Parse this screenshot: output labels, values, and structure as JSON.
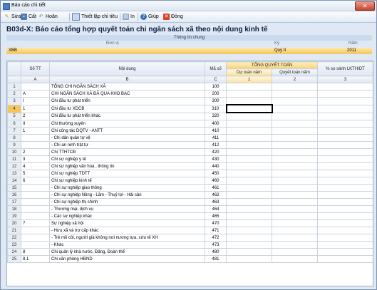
{
  "window": {
    "title": "Báo cáo chi tiết"
  },
  "toolbar": {
    "edit": "Sửa",
    "save": "Cất",
    "undo": "Hoãn",
    "setup": "Thiết lập chỉ tiêu",
    "print": "In",
    "help": "Giúp",
    "close": "Đóng"
  },
  "report": {
    "title": "B03d-X: Báo cáo tổng hợp quyết toán chi ngân sách xã theo nội dung kinh tế",
    "info_header": "Thông tin chung",
    "info_labels": {
      "unit": "Đơn vị",
      "period": "Kỳ",
      "year": "Năm"
    },
    "info_values": {
      "unit": "XBB",
      "period": "Quý II",
      "year": "2011"
    }
  },
  "table": {
    "headers": {
      "stt": "Số TT",
      "content": "Nội dung",
      "code": "Mã số",
      "summary": "TỔNG QUYẾT TOÁN",
      "estimate": "Dự toán năm",
      "settlement": "Quyết toán năm",
      "compare": "% so sánh LKTH/DT"
    },
    "letters": {
      "stt": "A",
      "content": "B",
      "code": "C",
      "estimate": "1",
      "settlement": "2",
      "compare": "3"
    },
    "rows": [
      {
        "n": "1",
        "stt": "",
        "content": "TỔNG CHI NGÂN SÁCH XÃ",
        "code": "100"
      },
      {
        "n": "2",
        "stt": "A",
        "content": "CHI NGÂN SÁCH XÃ ĐÃ QUA KHO BẠC",
        "code": "200"
      },
      {
        "n": "3",
        "stt": "I",
        "content": "Chi đầu tư phát triển",
        "code": "300"
      },
      {
        "n": "4",
        "stt": "1",
        "content": "Chi đầu tư XDCB",
        "code": "310"
      },
      {
        "n": "5",
        "stt": "2",
        "content": "Chi đầu tư phát triển khác",
        "code": "320"
      },
      {
        "n": "6",
        "stt": "II",
        "content": "Chi thường xuyên",
        "code": "400"
      },
      {
        "n": "7",
        "stt": "1",
        "content": "Chi công tác DQTV - ANTT",
        "code": "410"
      },
      {
        "n": "8",
        "stt": "",
        "content": " - Chi dân quân tự vệ",
        "code": "411"
      },
      {
        "n": "9",
        "stt": "",
        "content": " - Chi an ninh trật tự",
        "code": "412"
      },
      {
        "n": "10",
        "stt": "2",
        "content": "Chi TTHTCĐ",
        "code": "420"
      },
      {
        "n": "11",
        "stt": "3",
        "content": "Chi sự nghiệp y tế",
        "code": "430"
      },
      {
        "n": "12",
        "stt": "4",
        "content": "Chi sự nghiệp văn hoá , thông tin",
        "code": "440"
      },
      {
        "n": "13",
        "stt": "5",
        "content": "Chi sự nghiệp TDTT",
        "code": "450"
      },
      {
        "n": "14",
        "stt": "6",
        "content": "Chi sự nghiệp kinh tế",
        "code": "460"
      },
      {
        "n": "15",
        "stt": "",
        "content": " - Chi sự nghiệp giao thông",
        "code": "461"
      },
      {
        "n": "16",
        "stt": "",
        "content": " - Chi sự nghiệp Nông - Lâm - Thuỷ lợi - Hải sản",
        "code": "462"
      },
      {
        "n": "17",
        "stt": "",
        "content": " - Chi sự nghiệp thị chính",
        "code": "463"
      },
      {
        "n": "18",
        "stt": "",
        "content": " - Thương mại, dịch vụ",
        "code": "464"
      },
      {
        "n": "19",
        "stt": "",
        "content": " - Các sự nghiệp khác",
        "code": "465"
      },
      {
        "n": "20",
        "stt": "7",
        "content": "Sự nghiệp xã hội",
        "code": "470"
      },
      {
        "n": "21",
        "stt": "",
        "content": " - Hưu xã và trợ cấp khác",
        "code": "471"
      },
      {
        "n": "22",
        "stt": "",
        "content": " - Trẻ mồ côi, người già không nơi nương tựa, cứu tế XH",
        "code": "472"
      },
      {
        "n": "23",
        "stt": "",
        "content": " - Khác",
        "code": "473"
      },
      {
        "n": "24",
        "stt": "8",
        "content": "Chi quản lý nhà nước, Đảng, Đoàn thể",
        "code": "480"
      },
      {
        "n": "25",
        "stt": "8.1",
        "content": "Chi văn phòng HĐND",
        "code": "481"
      }
    ]
  },
  "colors": {
    "selected_row": "#f7c55a",
    "header_accent": "#f6d27a"
  }
}
